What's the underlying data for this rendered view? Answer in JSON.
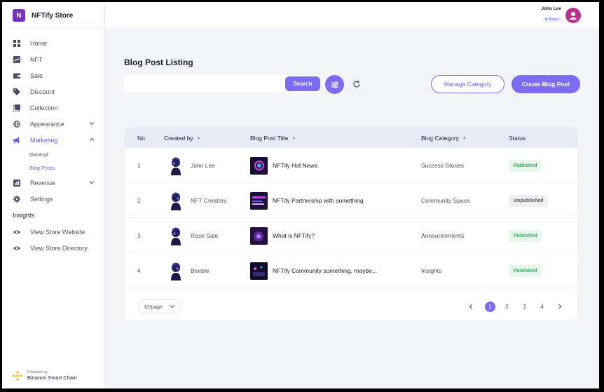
{
  "brand": {
    "logo_letter": "N",
    "name": "NFTify Store"
  },
  "nav": {
    "home": "Home",
    "nft": "NFT",
    "sale": "Sale",
    "discount": "Discount",
    "collection": "Collection",
    "appearance": "Appearance",
    "marketing": "Marketing",
    "general": "General",
    "blog_posts": "Blog Posts",
    "revenue": "Revenue",
    "settings": "Settings",
    "insights_header": "Insights",
    "view_store_website": "View Store Website",
    "view_store_directory": "View Store Directory"
  },
  "powered": {
    "line1": "Powered by",
    "line2": "Binance Smart Chain"
  },
  "user": {
    "name": "John Lee",
    "plan": "★ Basic"
  },
  "main": {
    "title": "Blog Post Listing",
    "search_placeholder": "",
    "search_label": "Search",
    "manage_category_label": "Manage Category",
    "create_post_label": "Create Blog Post"
  },
  "table": {
    "headers": {
      "no": "No",
      "created_by": "Created by",
      "title": "Blog Post Title",
      "category": "Blog Category",
      "status": "Status"
    },
    "rows": [
      {
        "no": "1",
        "author": "John Lee",
        "title": "NFTify Hot News",
        "category": "Success Stories",
        "status": "Published"
      },
      {
        "no": "2",
        "author": "NFT Creators",
        "title": "NFTify Partnership with something",
        "category": "Community Space",
        "status": "Unpublished"
      },
      {
        "no": "3",
        "author": "Rose Sale",
        "title": "What is NFTify?",
        "category": "Announcements",
        "status": "Published"
      },
      {
        "no": "4",
        "author": "Beeble",
        "title": "NFTify Community something, maybe...",
        "category": "Insights",
        "status": "Published"
      }
    ]
  },
  "pagination": {
    "page_size": "10/page",
    "pages": [
      "1",
      "2",
      "3",
      "4"
    ],
    "current": "1"
  },
  "colors": {
    "accent": "#7b6cf2",
    "brand": "#7b2fbf",
    "published_bg": "#e7f7ec",
    "published_fg": "#2fae5b"
  }
}
